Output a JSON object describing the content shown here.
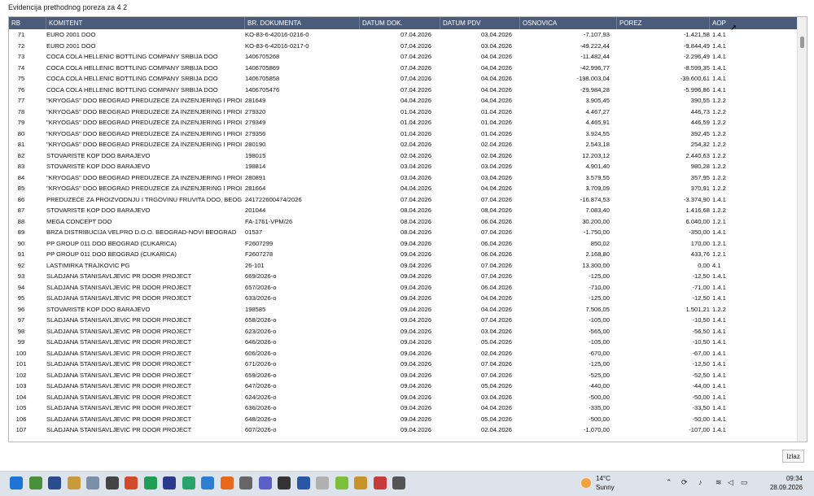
{
  "window": {
    "title": "Evidencija prethodnog poreza za 4 2"
  },
  "table": {
    "headers": [
      "RB",
      "KOMITENT",
      "BR. DOKUMENTA",
      "DATUM DOK.",
      "DATUM PDV",
      "OSNOVICA",
      "POREZ",
      "AOP"
    ],
    "rows": [
      [
        "71",
        "EURO 2001 DOO",
        "KO-83-6-42016-0216-0",
        "07.04.2026",
        "03.04.2026",
        "-7.107,93",
        "-1.421,58",
        "1.4.1"
      ],
      [
        "72",
        "EURO 2001 DOO",
        "KO-83-6-42016-0217-0",
        "07.04.2026",
        "03.04.2026",
        "-49.222,44",
        "-9.844,49",
        "1.4.1"
      ],
      [
        "73",
        "COCA COLA HELLENIC BOTTLING COMPANY SRBIJA DOO",
        "1406705268",
        "07.04.2026",
        "04.04.2026",
        "-11.482,44",
        "-2.296,49",
        "1.4.1"
      ],
      [
        "74",
        "COCA COLA HELLENIC BOTTLING COMPANY SRBIJA DOO",
        "1406705869",
        "07.04.2026",
        "04.04.2026",
        "-42.996,77",
        "-8.599,35",
        "1.4.1"
      ],
      [
        "75",
        "COCA COLA HELLENIC BOTTLING COMPANY SRBIJA DOO",
        "1406705858",
        "07.04.2026",
        "04.04.2026",
        "-198.003,04",
        "-39.600,61",
        "1.4.1"
      ],
      [
        "76",
        "COCA COLA HELLENIC BOTTLING COMPANY SRBIJA DOO",
        "1406705476",
        "07.04.2026",
        "04.04.2026",
        "-29.984,28",
        "-5.996,86",
        "1.4.1"
      ],
      [
        "77",
        "\"KRYOGAS\" DOO BEOGRAD PREDUZECE ZA INZENJERING I PROIZV...",
        "281649",
        "04.04.2026",
        "04.04.2026",
        "3.905,45",
        "390,55",
        "1.2.2"
      ],
      [
        "78",
        "\"KRYOGAS\" DOO BEOGRAD PREDUZECE ZA INZENJERING I PROIZV...",
        "279320",
        "01.04.2026",
        "01.04.2026",
        "4.467,27",
        "446,73",
        "1.2.2"
      ],
      [
        "79",
        "\"KRYOGAS\" DOO BEOGRAD PREDUZECE ZA INZENJERING I PROIZV...",
        "279349",
        "01.04.2026",
        "01.04.2026",
        "4.465,91",
        "446,59",
        "1.2.2"
      ],
      [
        "80",
        "\"KRYOGAS\" DOO BEOGRAD PREDUZECE ZA INZENJERING I PROIZV...",
        "279356",
        "01.04.2026",
        "01.04.2026",
        "3.924,55",
        "392,45",
        "1.2.2"
      ],
      [
        "81",
        "\"KRYOGAS\" DOO BEOGRAD PREDUZECE ZA INZENJERING I PROIZV...",
        "280190",
        "02.04.2026",
        "02.04.2026",
        "2.543,18",
        "254,32",
        "1.2.2"
      ],
      [
        "82",
        "STOVARISTE KOP DOO BARAJEVO",
        "198015",
        "02.04.2026",
        "02.04.2026",
        "12.203,12",
        "2.440,63",
        "1.2.2"
      ],
      [
        "83",
        "STOVARISTE KOP DOO BARAJEVO",
        "198814",
        "03.04.2026",
        "03.04.2026",
        "4.901,40",
        "980,28",
        "1.2.2"
      ],
      [
        "84",
        "\"KRYOGAS\" DOO BEOGRAD PREDUZECE ZA INZENJERING I PROIZV...",
        "280891",
        "03.04.2026",
        "03.04.2026",
        "3.579,55",
        "357,95",
        "1.2.2"
      ],
      [
        "85",
        "\"KRYOGAS\" DOO BEOGRAD PREDUZECE ZA INZENJERING I PROIZV...",
        "281664",
        "04.04.2026",
        "04.04.2026",
        "3.709,09",
        "370,91",
        "1.2.2"
      ],
      [
        "86",
        "PREDUZEĆE ZA PROIZVODNJU I TRGOVINU FRUVITA DOO, BEOGRA...",
        "241722600474/2026",
        "07.04.2026",
        "07.04.2026",
        "-16.874,53",
        "-3.374,90",
        "1.4.1"
      ],
      [
        "87",
        "STOVARISTE KOP DOO BARAJEVO",
        "201044",
        "08.04.2026",
        "08.04.2026",
        "7.083,40",
        "1.416,68",
        "1.2.2"
      ],
      [
        "88",
        "MEGA CONCEPT DOO",
        "FA-1761-VPM/26",
        "08.04.2026",
        "06.04.2026",
        "30.200,00",
        "6.040,00",
        "1.2.1"
      ],
      [
        "89",
        "BRZA DISTRIBUCIJA VELPRO D.O.O. BEOGRAD-NOVI BEOGRAD",
        "01537",
        "08.04.2026",
        "07.04.2026",
        "-1.750,00",
        "-350,00",
        "1.4.1"
      ],
      [
        "90",
        "PP GROUP 011 DOO BEOGRAD (CUKARICA)",
        "F2607299",
        "09.04.2026",
        "06.04.2026",
        "850,02",
        "170,00",
        "1.2.1"
      ],
      [
        "91",
        "PP GROUP 011 DOO BEOGRAD (CUKARICA)",
        "F2607278",
        "09.04.2026",
        "06.04.2026",
        "2.168,80",
        "433,76",
        "1.2.1"
      ],
      [
        "92",
        "LASTIMIRKA TRAJKOVIC PG",
        "26-101",
        "09.04.2026",
        "07.04.2026",
        "13.300,00",
        "0,00",
        "4.1"
      ],
      [
        "93",
        "SLADJANA STANISAVLJEVIC PR DOOR PROJECT",
        "669/2026-o",
        "09.04.2026",
        "07.04.2026",
        "-125,00",
        "-12,50",
        "1.4.1"
      ],
      [
        "94",
        "SLADJANA STANISAVLJEVIC PR DOOR PROJECT",
        "657/2026-o",
        "09.04.2026",
        "06.04.2026",
        "-710,00",
        "-71,00",
        "1.4.1"
      ],
      [
        "95",
        "SLADJANA STANISAVLJEVIC PR DOOR PROJECT",
        "633/2026-o",
        "09.04.2026",
        "04.04.2026",
        "-125,00",
        "-12,50",
        "1.4.1"
      ],
      [
        "96",
        "STOVARISTE KOP DOO BARAJEVO",
        "198585",
        "09.04.2026",
        "04.04.2026",
        "7.506,05",
        "1.501,21",
        "1.2.2"
      ],
      [
        "97",
        "SLADJANA STANISAVLJEVIC PR DOOR PROJECT",
        "658/2026-o",
        "09.04.2026",
        "07.04.2026",
        "-105,00",
        "-10,50",
        "1.4.1"
      ],
      [
        "98",
        "SLADJANA STANISAVLJEVIC PR DOOR PROJECT",
        "623/2026-o",
        "09.04.2026",
        "03.04.2026",
        "-565,00",
        "-56,50",
        "1.4.1"
      ],
      [
        "99",
        "SLADJANA STANISAVLJEVIC PR DOOR PROJECT",
        "646/2026-o",
        "09.04.2026",
        "05.04.2026",
        "-105,00",
        "-10,50",
        "1.4.1"
      ],
      [
        "100",
        "SLADJANA STANISAVLJEVIC PR DOOR PROJECT",
        "606/2026-o",
        "09.04.2026",
        "02.04.2026",
        "-670,00",
        "-67,00",
        "1.4.1"
      ],
      [
        "101",
        "SLADJANA STANISAVLJEVIC PR DOOR PROJECT",
        "671/2026-o",
        "09.04.2026",
        "07.04.2026",
        "-125,00",
        "-12,50",
        "1.4.1"
      ],
      [
        "102",
        "SLADJANA STANISAVLJEVIC PR DOOR PROJECT",
        "659/2026-o",
        "09.04.2026",
        "07.04.2026",
        "-525,00",
        "-52,50",
        "1.4.1"
      ],
      [
        "103",
        "SLADJANA STANISAVLJEVIC PR DOOR PROJECT",
        "647/2026-o",
        "09.04.2026",
        "05.04.2026",
        "-440,00",
        "-44,00",
        "1.4.1"
      ],
      [
        "104",
        "SLADJANA STANISAVLJEVIC PR DOOR PROJECT",
        "624/2026-o",
        "09.04.2026",
        "03.04.2026",
        "-500,00",
        "-50,00",
        "1.4.1"
      ],
      [
        "105",
        "SLADJANA STANISAVLJEVIC PR DOOR PROJECT",
        "636/2026-o",
        "09.04.2026",
        "04.04.2026",
        "-335,00",
        "-33,50",
        "1.4.1"
      ],
      [
        "106",
        "SLADJANA STANISAVLJEVIC PR DOOR PROJECT",
        "648/2026-o",
        "09.04.2026",
        "05.04.2026",
        "-500,00",
        "-50,00",
        "1.4.1"
      ],
      [
        "107",
        "SLADJANA STANISAVLJEVIC PR DOOR PROJECT",
        "607/2026-o",
        "09.04.2026",
        "02.04.2026",
        "-1.070,00",
        "-107,00",
        "1.4.1"
      ]
    ]
  },
  "footer": {
    "close_label": "Izlaz"
  },
  "taskbar": {
    "icons": [
      "windows-start-icon",
      "explorer-icon",
      "save-app-icon",
      "archive-app-icon",
      "sql-app-icon",
      "mail-app-icon",
      "report-app-icon",
      "spreadsheet-app-icon",
      "remote-desktop-icon",
      "chat-app-icon",
      "photos-app-icon",
      "firefox-icon",
      "tools-app-icon",
      "teams-icon",
      "settings-app-icon",
      "document-app-icon",
      "files-app-icon",
      "green-app-icon",
      "pdf-app-icon",
      "notes-app-icon",
      "print-app-icon"
    ],
    "weather": {
      "temp": "14°C",
      "desc": "Sunny"
    },
    "clock": {
      "time": "09:34",
      "date": "28.09.2026"
    }
  },
  "colors": {
    "header_bg": "#4b5c7a",
    "taskbar_bg": "#dde3ea"
  }
}
